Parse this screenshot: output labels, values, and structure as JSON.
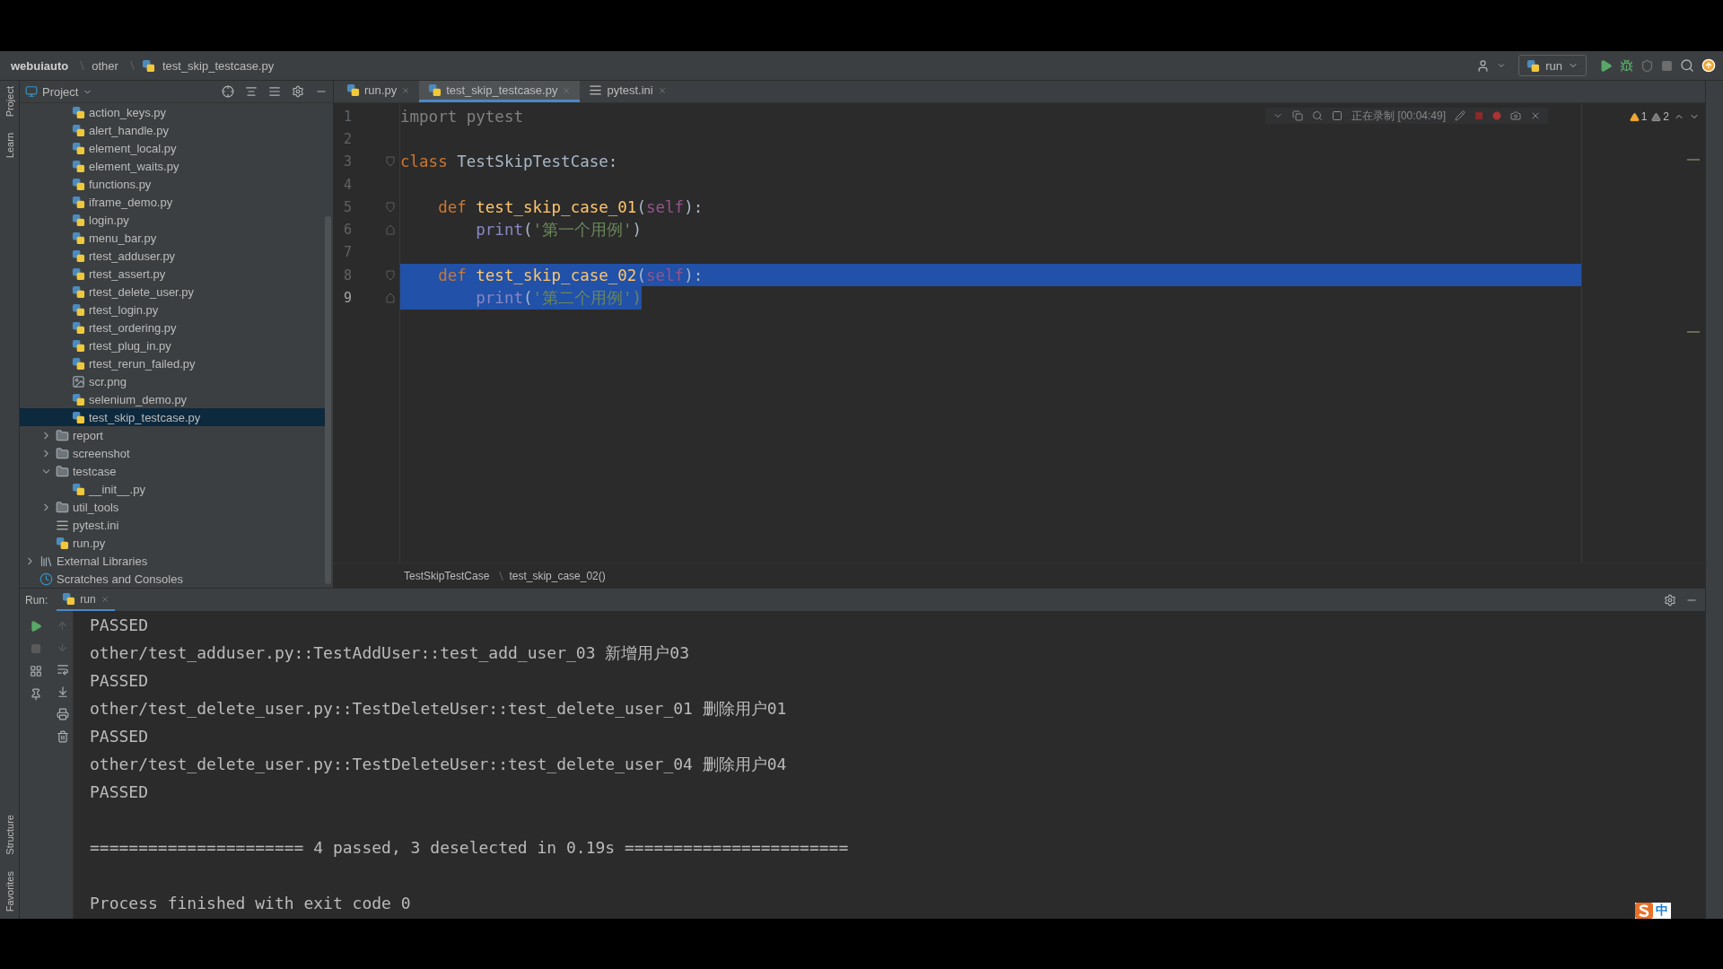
{
  "navbar": {
    "breadcrumb": [
      "webuiauto",
      "other",
      "test_skip_testcase.py"
    ],
    "run_config": "run"
  },
  "tool_strip": {
    "top": [
      "Project",
      "Learn"
    ],
    "bottom": [
      "Structure",
      "Favorites"
    ]
  },
  "project": {
    "title": "Project",
    "tree": [
      {
        "children": [
          {
            "children": [
              {
                "label": "action_keys.py",
                "kind": "python",
                "selected": false
              },
              {
                "label": "alert_handle.py",
                "kind": "python",
                "selected": false
              },
              {
                "label": "element_local.py",
                "kind": "python",
                "selected": false
              },
              {
                "label": "element_waits.py",
                "kind": "python",
                "selected": false
              },
              {
                "label": "functions.py",
                "kind": "python",
                "selected": false
              },
              {
                "label": "iframe_demo.py",
                "kind": "python",
                "selected": false
              },
              {
                "label": "login.py",
                "kind": "python",
                "selected": false
              },
              {
                "label": "menu_bar.py",
                "kind": "python",
                "selected": false
              },
              {
                "label": "rtest_adduser.py",
                "kind": "python",
                "selected": false
              },
              {
                "label": "rtest_assert.py",
                "kind": "python",
                "selected": false
              },
              {
                "label": "rtest_delete_user.py",
                "kind": "python",
                "selected": false
              },
              {
                "label": "rtest_login.py",
                "kind": "python",
                "selected": false
              },
              {
                "label": "rtest_ordering.py",
                "kind": "python",
                "selected": false
              },
              {
                "label": "rtest_plug_in.py",
                "kind": "python",
                "selected": false
              },
              {
                "label": "rtest_rerun_failed.py",
                "kind": "python",
                "selected": false
              },
              {
                "label": "scr.png",
                "kind": "image",
                "selected": false
              },
              {
                "label": "selenium_demo.py",
                "kind": "python",
                "selected": false
              },
              {
                "label": "test_skip_testcase.py",
                "kind": "python",
                "selected": true
              }
            ]
          },
          {
            "label": "report",
            "kind": "folder",
            "expanded": false,
            "selected": false
          },
          {
            "label": "screenshot",
            "kind": "folder",
            "expanded": false,
            "selected": false
          },
          {
            "label": "testcase",
            "kind": "folder",
            "expanded": true,
            "selected": false,
            "children": [
              {
                "label": "__init__.py",
                "kind": "python",
                "selected": false
              }
            ]
          },
          {
            "label": "util_tools",
            "kind": "folder",
            "expanded": false,
            "selected": false
          },
          {
            "label": "pytest.ini",
            "kind": "ini",
            "selected": false
          },
          {
            "label": "run.py",
            "kind": "python",
            "selected": false
          }
        ]
      },
      {
        "label": "External Libraries",
        "kind": "libraries",
        "expanded": false,
        "selected": false
      },
      {
        "label": "Scratches and Consoles",
        "kind": "scratches",
        "selected": false
      }
    ]
  },
  "editor_tabs": [
    {
      "label": "run.py",
      "kind": "python",
      "selected": false
    },
    {
      "label": "test_skip_testcase.py",
      "kind": "python",
      "selected": true
    },
    {
      "label": "pytest.ini",
      "kind": "ini",
      "selected": false
    }
  ],
  "recording": {
    "label": "正在录制 [00:04:49]"
  },
  "inspections": {
    "warnings": "1",
    "weak_warnings": "2"
  },
  "code": [
    {
      "number": "1",
      "current": false,
      "selected": false,
      "tokens": [
        {
          "text": "import pytest",
          "kind": "unused"
        }
      ]
    },
    {
      "number": "2",
      "current": false,
      "selected": false
    },
    {
      "number": "3",
      "current": false,
      "selected": false,
      "kind": "fold-start",
      "tokens": [
        {
          "text": "class ",
          "kind": "keyword"
        },
        {
          "text": "TestSkipTestCase:",
          "kind": "plain"
        }
      ]
    },
    {
      "number": "4",
      "current": false,
      "selected": false
    },
    {
      "number": "5",
      "current": false,
      "selected": false,
      "kind": "fold-start",
      "tokens": [
        {
          "text": "    def ",
          "kind": "keyword"
        },
        {
          "text": "test_skip_case_01",
          "kind": "func"
        },
        {
          "text": "(",
          "kind": "plain"
        },
        {
          "text": "self",
          "kind": "self"
        },
        {
          "text": "):",
          "kind": "plain"
        }
      ]
    },
    {
      "number": "6",
      "current": false,
      "selected": false,
      "kind": "fold-end",
      "tokens": [
        {
          "text": "        print",
          "kind": "builtin"
        },
        {
          "text": "(",
          "kind": "plain"
        },
        {
          "text": "'第一个用例'",
          "kind": "string"
        },
        {
          "text": ")",
          "kind": "plain"
        }
      ]
    },
    {
      "number": "7",
      "current": false,
      "selected": false
    },
    {
      "number": "8",
      "current": false,
      "selected": true,
      "kind": "fold-start",
      "tokens": [
        {
          "text": "    def ",
          "kind": "keyword"
        },
        {
          "text": "test_skip_case_02",
          "kind": "func"
        },
        {
          "text": "(",
          "kind": "plain"
        },
        {
          "text": "self",
          "kind": "self"
        },
        {
          "text": "):",
          "kind": "plain"
        }
      ]
    },
    {
      "number": "9",
      "current": true,
      "selected": true,
      "kind": "fold-end",
      "tokens": [
        {
          "text": "        print",
          "kind": "builtin"
        },
        {
          "text": "(",
          "kind": "plain"
        },
        {
          "text": "'第二个用例')",
          "kind": "string"
        }
      ]
    }
  ],
  "editor_breadcrumb": [
    "TestSkipTestCase",
    "test_skip_case_02()"
  ],
  "run": {
    "title": "Run:",
    "tab": "run",
    "output": [
      {
        "text": "PASSED",
        "kind": "line"
      },
      {
        "text": "other/test_adduser.py::TestAddUser::test_add_user_03 新增用户03",
        "kind": "line"
      },
      {
        "text": "PASSED",
        "kind": "line"
      },
      {
        "text": "other/test_delete_user.py::TestDeleteUser::test_delete_user_01 删除用户01",
        "kind": "line"
      },
      {
        "text": "PASSED",
        "kind": "line"
      },
      {
        "text": "other/test_delete_user.py::TestDeleteUser::test_delete_user_04 删除用户04",
        "kind": "line"
      },
      {
        "text": "PASSED",
        "kind": "line"
      },
      {
        "text": "====================== 4 passed, 3 deselected in 0.19s =======================",
        "kind": "after-blank"
      },
      {
        "text": "Process finished with exit code 0",
        "kind": "after-blank"
      }
    ]
  },
  "ime": {
    "label": "中"
  }
}
